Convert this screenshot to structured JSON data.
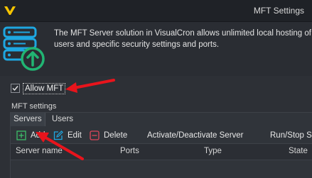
{
  "window": {
    "title": "MFT Settings"
  },
  "intro": {
    "line1": "The MFT Server solution in VisualCron allows unlimited local hosting of e",
    "line2": "users and specific security settings and ports."
  },
  "allow_mft": {
    "label": "Allow MFT",
    "checked": true
  },
  "settings": {
    "group_label": "MFT settings"
  },
  "tabs": [
    {
      "label": "Servers"
    },
    {
      "label": "Users"
    }
  ],
  "toolbar": {
    "add_label": "Add",
    "edit_label": "Edit",
    "delete_label": "Delete",
    "activate_label": "Activate/Deactivate Server",
    "runstop_label": "Run/Stop S"
  },
  "grid": {
    "columns": [
      "Server name",
      "Ports",
      "Type",
      "State"
    ]
  },
  "colors": {
    "accent": "#1ea7e1",
    "upload_green": "#21b573",
    "add_green": "#3dbf6a",
    "delete_red": "#e0465a",
    "annotation_red": "#e8141c"
  }
}
